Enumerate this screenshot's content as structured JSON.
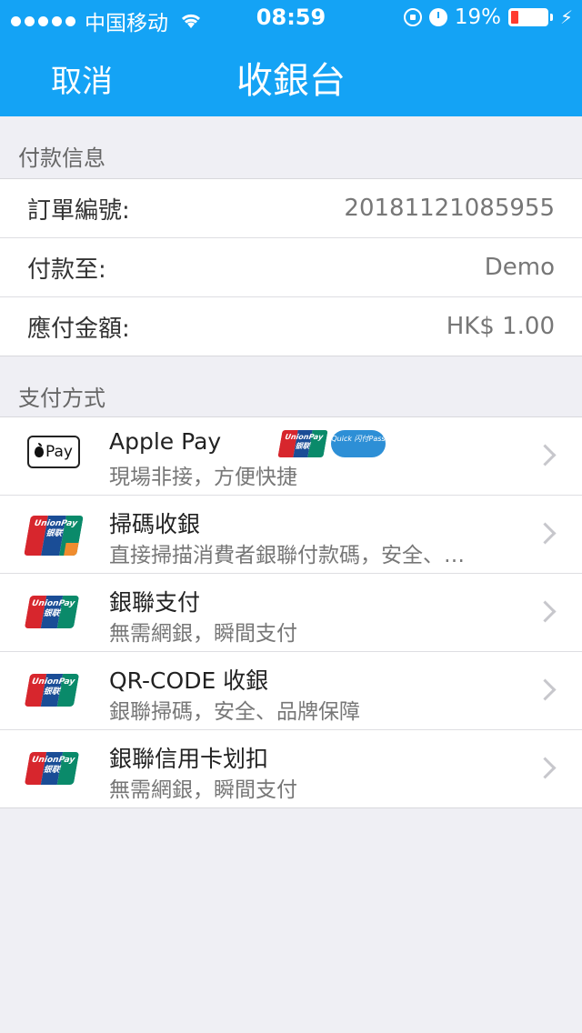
{
  "status_bar": {
    "carrier": "中国移动",
    "time": "08:59",
    "battery": "19%",
    "icons": [
      "signal-dots-icon",
      "wifi-icon",
      "rotation-lock-icon",
      "alarm-icon",
      "battery-icon",
      "charging-icon"
    ]
  },
  "nav": {
    "cancel_label": "取消",
    "title": "收銀台"
  },
  "payment_info": {
    "header": "付款信息",
    "rows": [
      {
        "label": "訂單編號:",
        "value": "20181121085955"
      },
      {
        "label": "付款至:",
        "value": "Demo"
      },
      {
        "label": "應付金額:",
        "value": "HK$ 1.00"
      }
    ]
  },
  "payment_methods": {
    "header": "支付方式",
    "apple_pay_logo_text": "Pay",
    "unionpay_logo_text": "UnionPay 银联",
    "quickpass_badge_text": "Quick 闪付Pass",
    "items": [
      {
        "title": "Apple Pay",
        "subtitle": "現場非接，方便快捷",
        "logo": "apple-pay-icon"
      },
      {
        "title": "掃碼收銀",
        "subtitle": "直接掃描消費者銀聯付款碼，安全、…",
        "logo": "unionpay-qr-icon"
      },
      {
        "title": "銀聯支付",
        "subtitle": "無需網銀，瞬間支付",
        "logo": "unionpay-icon"
      },
      {
        "title": "QR-CODE 收銀",
        "subtitle": "銀聯掃碼，安全、品牌保障",
        "logo": "unionpay-icon"
      },
      {
        "title": "銀聯信用卡划扣",
        "subtitle": "無需網銀，瞬間支付",
        "logo": "unionpay-icon"
      }
    ]
  },
  "colors": {
    "nav_bg": "#14a3f5",
    "page_bg": "#efeff4",
    "battery_low": "#ff3b30"
  }
}
